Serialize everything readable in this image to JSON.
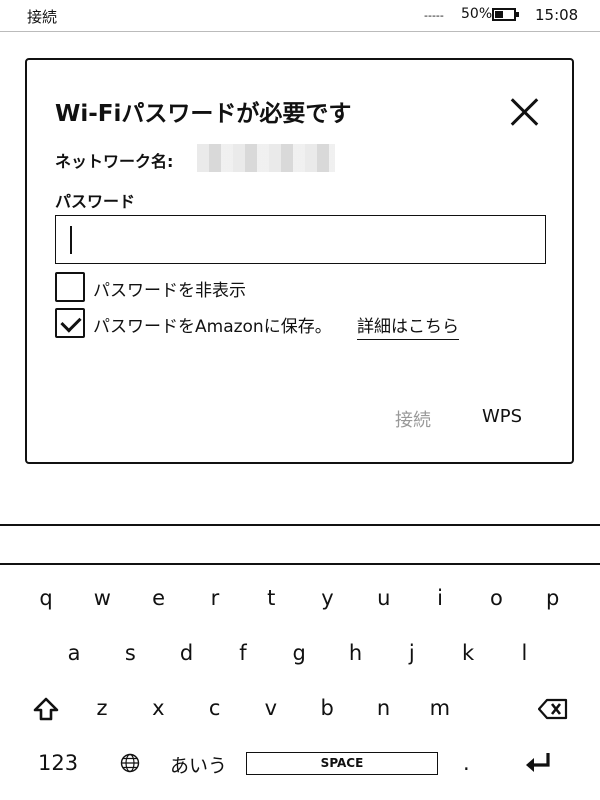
{
  "status_bar": {
    "connection": "接続",
    "signal": "-----",
    "battery_percent_label": "50%",
    "battery_level": 0.5,
    "time": "15:08"
  },
  "dialog": {
    "title": "Wi-Fiパスワードが必要です",
    "network_label": "ネットワーク名:",
    "network_name_redacted": true,
    "password_label": "パスワード",
    "password_value": "",
    "hide_password": {
      "label": "パスワードを非表示",
      "checked": false
    },
    "save_password": {
      "label": "パスワードをAmazonに保存。",
      "checked": true
    },
    "details_link": "詳細はこちら",
    "connect_button": "接続",
    "wps_button": "WPS"
  },
  "keyboard": {
    "row1": [
      "q",
      "w",
      "e",
      "r",
      "t",
      "y",
      "u",
      "i",
      "o",
      "p"
    ],
    "row2": [
      "a",
      "s",
      "d",
      "f",
      "g",
      "h",
      "j",
      "k",
      "l"
    ],
    "row3": [
      "z",
      "x",
      "c",
      "v",
      "b",
      "n",
      "m"
    ],
    "numbers_key": "123",
    "kana_key": "あいう",
    "space_key": "SPACE",
    "period_key": "."
  },
  "colors": {
    "text": "#111111",
    "disabled": "#999999",
    "background": "#ffffff"
  },
  "icons": [
    "close-icon",
    "shift-icon",
    "backspace-icon",
    "globe-icon",
    "enter-icon",
    "battery-icon",
    "checkmark-icon"
  ]
}
